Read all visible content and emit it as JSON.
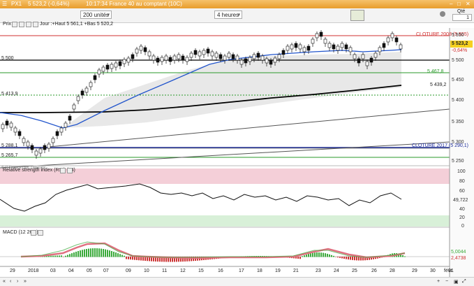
{
  "topbar": {
    "instrument": "PX1",
    "price_change": "5 523,2 (-0,64%)",
    "timestamp": "10:17:34 France 40 au comptant (10C)"
  },
  "toolbar": {
    "units_select": "200 unités",
    "period_select": "4 heures",
    "qty_label": "Qté",
    "qty_value": "1"
  },
  "price_panel": {
    "title": "Prix",
    "info": "Jour :+Haut 5 561,1 +Bas 5 520,2",
    "cloture_2008": "CLOTURE 2008 (5 555)",
    "cloture_2017": "CLOTURE 2017 (5 290,1)",
    "last_price": "5 523,2",
    "last_change": "-0,64%",
    "level_5500": "5 500",
    "level_5467": "5 467,8",
    "level_5439": "5 439,2",
    "level_5413": "5 413,9",
    "level_5288": "5 288,1",
    "level_5265": "5 265,7",
    "axis_labels": [
      "5 550",
      "5 500",
      "5 450",
      "5 400",
      "5 350",
      "5 300",
      "5 250"
    ],
    "copyright": "© IT-Finance.com, Datacopy"
  },
  "rsi_panel": {
    "title": "Relative strength index (RSI) (14)",
    "value": "49,722",
    "axis_labels": [
      "100",
      "80",
      "60",
      "40",
      "20",
      "0"
    ]
  },
  "macd_panel": {
    "title": "MACD (12 26 9)",
    "value1": "5,0044",
    "value2": "2,4738"
  },
  "x_axis": {
    "labels": [
      "29",
      "2018",
      "03",
      "04",
      "05",
      "07",
      "09",
      "10",
      "11",
      "12",
      "15",
      "16",
      "17",
      "18",
      "19",
      "21",
      "23",
      "24",
      "25",
      "26",
      "28",
      "29",
      "30",
      "31",
      "févr."
    ]
  },
  "colors": {
    "topbar": "#e89c2c",
    "candle_up": "#ffffff",
    "candle_down": "#111111",
    "ma_blue": "#2255cc",
    "ma_black": "#000000",
    "cloture_2008": "#d03030",
    "cloture_2017": "#1a2a9a",
    "support_green": "#2a9a2a",
    "rsi_zone": "#f4cfd8",
    "rsi_green_zone": "#d8f0d8",
    "macd_green": "#3aaa3a",
    "macd_red": "#cc3333"
  }
}
